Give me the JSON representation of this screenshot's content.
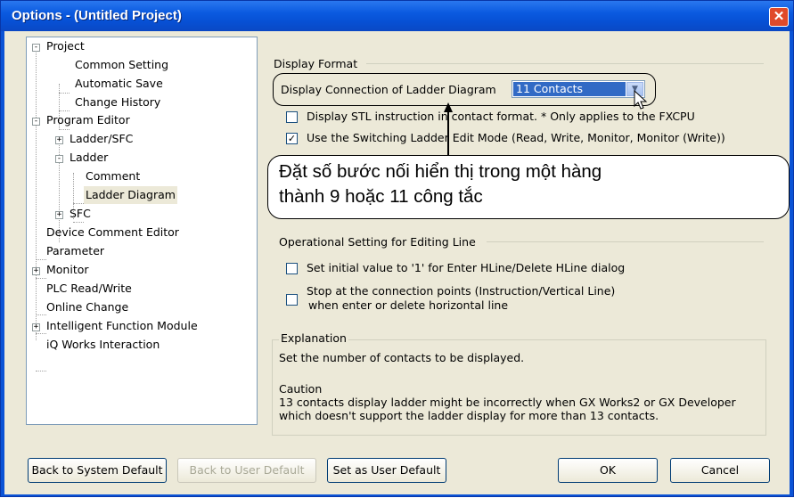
{
  "window": {
    "title": "Options - (Untitled Project)",
    "close_icon": "close-icon"
  },
  "tree": {
    "project": "Project",
    "common_setting": "Common Setting",
    "automatic_save": "Automatic Save",
    "change_history": "Change History",
    "program_editor": "Program Editor",
    "ladder_sfc": "Ladder/SFC",
    "ladder": "Ladder",
    "comment": "Comment",
    "ladder_diagram": "Ladder Diagram",
    "sfc": "SFC",
    "device_comment_editor": "Device Comment Editor",
    "parameter": "Parameter",
    "monitor": "Monitor",
    "plc_read_write": "PLC Read/Write",
    "online_change": "Online Change",
    "intelligent_function_module": "Intelligent Function Module",
    "iq_works_interaction": "iQ Works Interaction"
  },
  "display_format": {
    "group_title": "Display Format",
    "connection_label": "Display Connection of Ladder Diagram",
    "connection_value": "11 Contacts",
    "stl_label": "Display STL instruction in contact format.  * Only applies to the FXCPU",
    "stl_checked": false,
    "switching_label": "Use the Switching Ladder Edit Mode (Read, Write, Monitor, Monitor (Write))",
    "switching_checked": true
  },
  "callout": {
    "line1": "Đặt số bước nối hiển thị trong một hàng",
    "line2": "thành 9 hoặc 11 công tắc"
  },
  "operational": {
    "group_title": "Operational Setting for Editing Line",
    "initial_value_label": "Set initial value to '1' for Enter HLine/Delete HLine dialog",
    "initial_value_checked": false,
    "stop_label_line1": "Stop at the connection points (Instruction/Vertical Line)",
    "stop_label_line2": "when enter or delete horizontal line",
    "stop_checked": false
  },
  "explanation": {
    "group_title": "Explanation",
    "text": "Set the number of contacts to be displayed.",
    "caution_title": "Caution",
    "caution_line1": "13 contacts display ladder might be incorrectly when GX Works2 or GX Developer",
    "caution_line2": "which doesn't support the ladder display for more than 13 contacts."
  },
  "buttons": {
    "back_to_system_default": "Back to System Default",
    "back_to_user_default": "Back to User Default",
    "set_as_user_default": "Set as User Default",
    "ok": "OK",
    "cancel": "Cancel"
  }
}
